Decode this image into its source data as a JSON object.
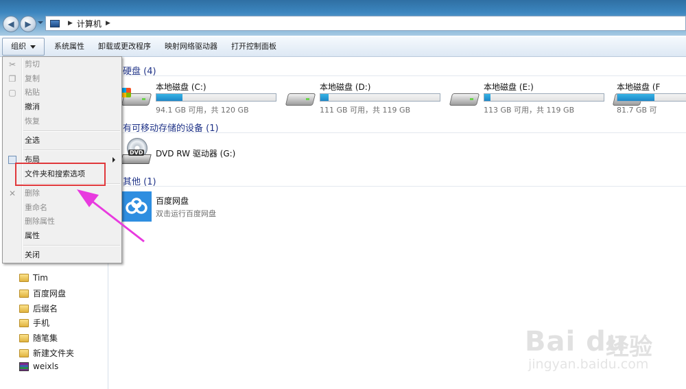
{
  "window": {
    "breadcrumb": [
      "计算机"
    ]
  },
  "toolbar": {
    "organize": "组织",
    "items": [
      "系统属性",
      "卸载或更改程序",
      "映射网络驱动器",
      "打开控制面板"
    ]
  },
  "menu": {
    "items": [
      {
        "label": "剪切",
        "enabled": false,
        "icon": "scissors-icon"
      },
      {
        "label": "复制",
        "enabled": false,
        "icon": "copy-icon"
      },
      {
        "label": "粘贴",
        "enabled": false,
        "icon": "paste-icon"
      },
      {
        "label": "撤消",
        "enabled": true
      },
      {
        "label": "恢复",
        "enabled": false
      },
      {
        "label": "全选",
        "enabled": true
      },
      {
        "label": "布局",
        "enabled": true,
        "submenu": true,
        "icon": "layout-icon"
      },
      {
        "label": "文件夹和搜索选项",
        "enabled": true,
        "highlighted": true
      },
      {
        "label": "删除",
        "enabled": false,
        "icon": "delete-x-icon"
      },
      {
        "label": "重命名",
        "enabled": false
      },
      {
        "label": "删除属性",
        "enabled": false
      },
      {
        "label": "属性",
        "enabled": true
      },
      {
        "label": "关闭",
        "enabled": true
      }
    ],
    "highlight_color": "#e0373a"
  },
  "nav": {
    "items": [
      {
        "label": "Tim",
        "icon": "folder-icon"
      },
      {
        "label": "百度网盘",
        "icon": "folder-icon"
      },
      {
        "label": "后缀名",
        "icon": "folder-icon"
      },
      {
        "label": "手机",
        "icon": "folder-icon"
      },
      {
        "label": "随笔集",
        "icon": "folder-icon"
      },
      {
        "label": "新建文件夹",
        "icon": "folder-icon"
      },
      {
        "label": "weixls",
        "icon": "winrar-icon"
      }
    ]
  },
  "content": {
    "groups": {
      "hdd": "硬盘 (4)",
      "removable": "有可移动存储的设备 (1)",
      "other": "其他 (1)"
    },
    "drives": [
      {
        "name": "本地磁盘 (C:)",
        "free": "94.1 GB 可用，共 120 GB",
        "used_fraction": 0.22
      },
      {
        "name": "本地磁盘 (D:)",
        "free": "111 GB 可用，共 119 GB",
        "used_fraction": 0.07
      },
      {
        "name": "本地磁盘 (E:)",
        "free": "113 GB 可用，共 119 GB",
        "used_fraction": 0.05
      },
      {
        "name": "本地磁盘 (F",
        "free": "81.7 GB 可",
        "used_fraction": 0.31
      }
    ],
    "dvd": {
      "name": "DVD RW 驱动器 (G:)",
      "badge": "DVD"
    },
    "other_app": {
      "name": "百度网盘",
      "desc": "双击运行百度网盘"
    }
  },
  "annotation": {
    "arrow_color": "#e83adf"
  },
  "watermark": {
    "brand": "Bai du",
    "cn": "经验",
    "url": "jingyan.baidu.com"
  }
}
